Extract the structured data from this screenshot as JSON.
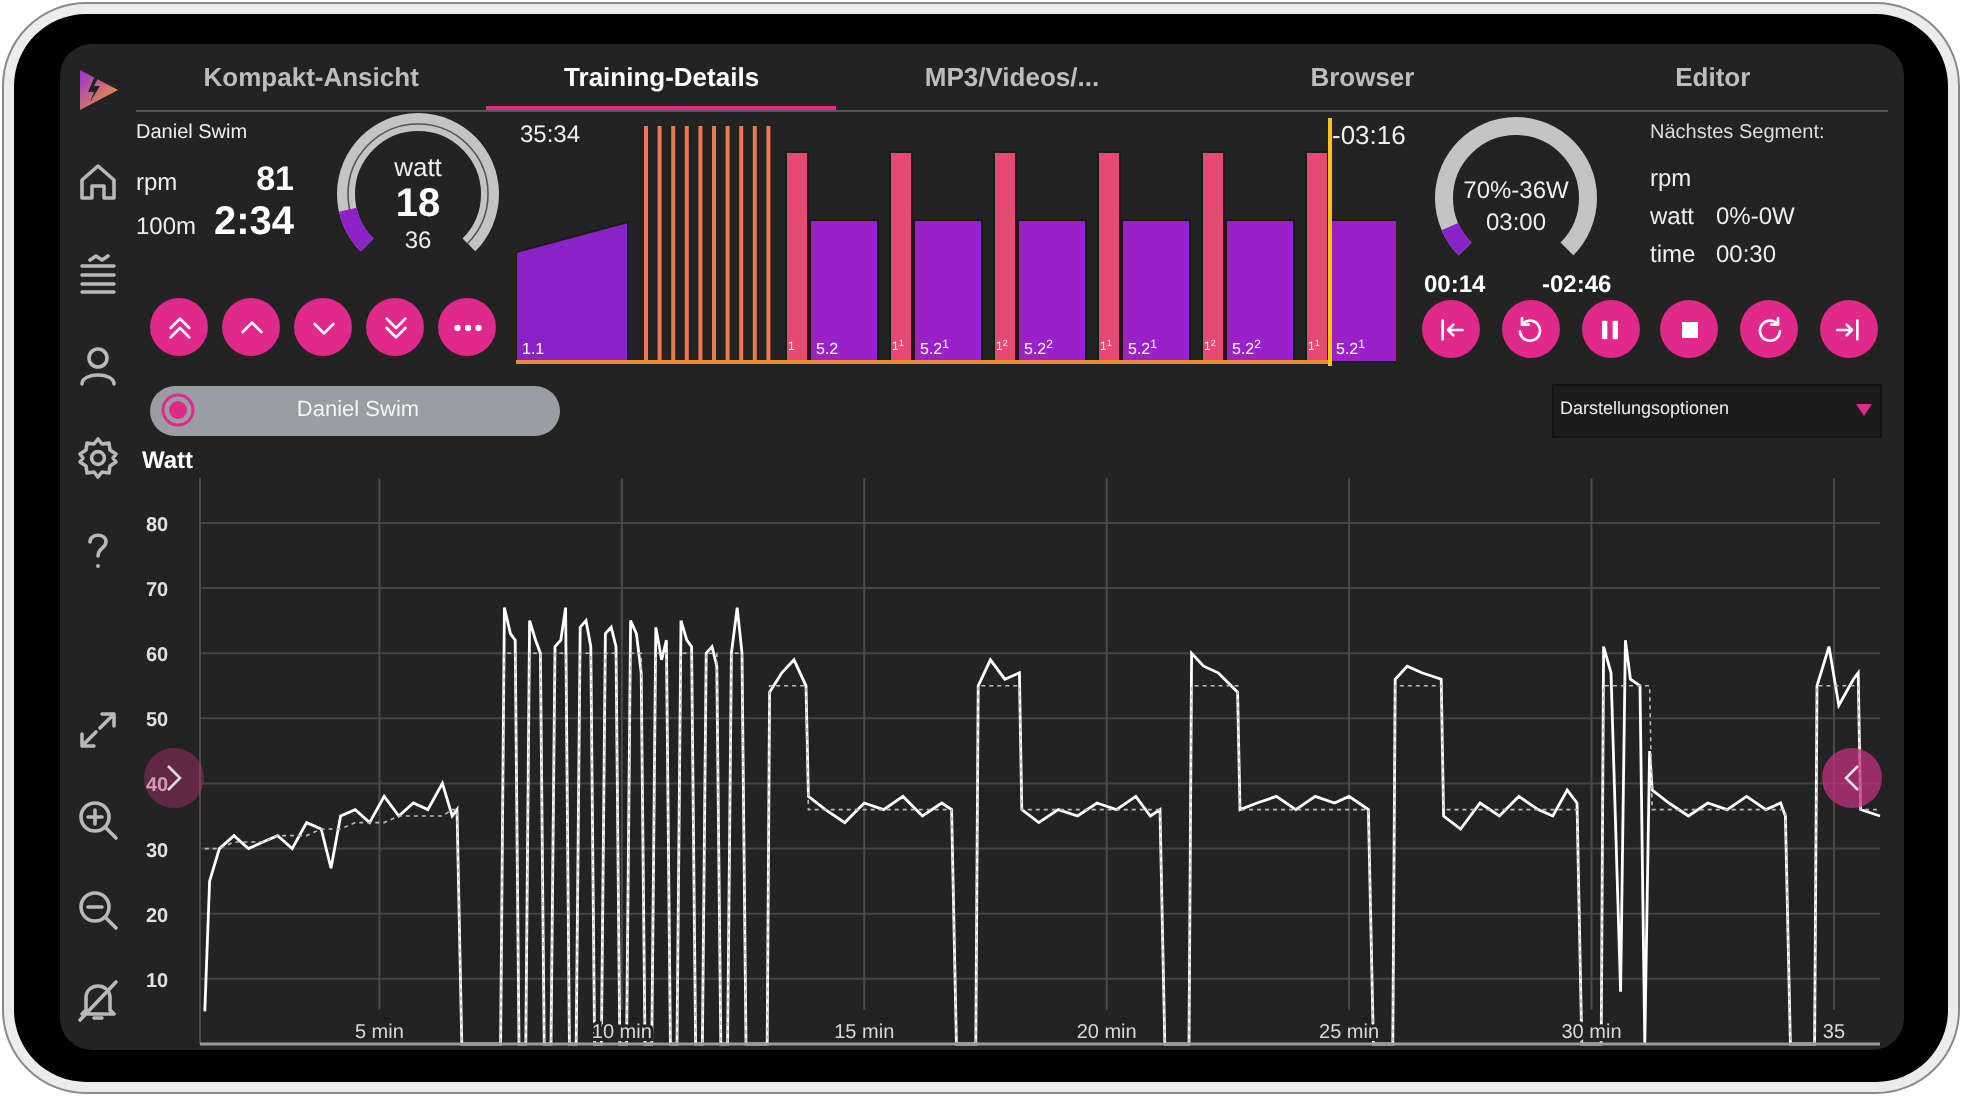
{
  "tabs": [
    {
      "label": "Kompakt-Ansicht",
      "selected": false
    },
    {
      "label": "Training-Details",
      "selected": true
    },
    {
      "label": "MP3/Videos/...",
      "selected": false
    },
    {
      "label": "Browser",
      "selected": false
    },
    {
      "label": "Editor",
      "selected": false
    }
  ],
  "rider": {
    "name": "Daniel Swim",
    "metrics": [
      {
        "label": "rpm",
        "value": "81"
      },
      {
        "label": "100m",
        "value": "2:34"
      }
    ]
  },
  "power_gauge": {
    "label": "watt",
    "value": "18",
    "target": "36",
    "level": 0.12
  },
  "workout_profile": {
    "elapsed": "35:34",
    "remaining": "-03:16",
    "level": 0.925,
    "segments": [
      {
        "kind": "ramp",
        "label": "1.1"
      },
      {
        "kind": "sprint"
      },
      {
        "kind": "sprint"
      },
      {
        "kind": "sprint"
      },
      {
        "kind": "sprint"
      },
      {
        "kind": "sprint"
      },
      {
        "kind": "sprint"
      },
      {
        "kind": "sprint"
      },
      {
        "kind": "sprint"
      },
      {
        "kind": "sprint"
      },
      {
        "kind": "sprint"
      },
      {
        "kind": "interval",
        "label": "1"
      },
      {
        "kind": "recovery",
        "label": "5.2"
      },
      {
        "kind": "interval",
        "label": "1$^{1}$"
      },
      {
        "kind": "recovery",
        "label": "5.2$^{1}$"
      },
      {
        "kind": "interval",
        "label": "1$^{2}$"
      },
      {
        "kind": "recovery",
        "label": "5.2$^{2}$"
      },
      {
        "kind": "interval",
        "label": "1$^{1}$"
      },
      {
        "kind": "recovery",
        "label": "5.2$^{1}$"
      },
      {
        "kind": "interval",
        "label": "1$^{2}$"
      },
      {
        "kind": "recovery",
        "label": "5.2$^{2}$"
      },
      {
        "kind": "interval",
        "label": "1$^{1}$"
      },
      {
        "kind": "recovery",
        "label": "5.2$^{1}$"
      }
    ]
  },
  "segment_gauge": {
    "target": "70%-36W",
    "duration": "03:00",
    "level": 0.08,
    "elapsed": "00:14",
    "remaining": "-02:46"
  },
  "next_segment": {
    "title": "Nächstes Segment:",
    "rows": [
      {
        "label": "rpm"
      },
      {
        "label": "watt",
        "value": "0%-0W"
      },
      {
        "label": "time",
        "value": "00:30"
      }
    ]
  },
  "user_chip": {
    "name": "Daniel Swim"
  },
  "display_options": {
    "label": "Darstellungsoptionen"
  },
  "power_chart": {
    "chart_data": {
      "type": "line",
      "ylabel": "Watt",
      "grid": true,
      "xlim": [
        1.3,
        35.95
      ],
      "ylim": [
        0,
        86.9
      ],
      "yticks": [
        10,
        20,
        30,
        40,
        50,
        60,
        70,
        80
      ],
      "xticks": [
        {
          "value": 5,
          "label": "5 min"
        },
        {
          "value": 10,
          "label": "10 min"
        },
        {
          "value": 15,
          "label": "15 min"
        },
        {
          "value": 20,
          "label": "20 min"
        },
        {
          "value": 25,
          "label": "25 min"
        },
        {
          "value": 30,
          "label": "30 min"
        },
        {
          "value": 35,
          "label": "35"
        }
      ],
      "x": [
        1.4,
        1.5,
        1.7,
        2.0,
        2.3,
        2.6,
        2.9,
        3.2,
        3.5,
        3.8,
        4.0,
        4.2,
        4.5,
        4.8,
        5.1,
        5.4,
        5.7,
        6.0,
        6.3,
        6.5,
        6.6,
        6.7,
        7.4,
        7.5,
        7.58,
        7.7,
        7.8,
        7.88,
        8.02,
        8.1,
        8.22,
        8.32,
        8.4,
        8.54,
        8.62,
        8.74,
        8.84,
        8.92,
        9.06,
        9.14,
        9.26,
        9.36,
        9.44,
        9.58,
        9.66,
        9.78,
        9.88,
        9.96,
        10.1,
        10.18,
        10.3,
        10.4,
        10.48,
        10.62,
        10.7,
        10.82,
        10.92,
        11.0,
        11.14,
        11.22,
        11.34,
        11.44,
        11.52,
        11.66,
        11.74,
        11.86,
        11.96,
        12.04,
        12.18,
        12.26,
        12.38,
        12.48,
        12.56,
        12.9,
        13.0,
        13.05,
        13.3,
        13.55,
        13.8,
        13.85,
        14.2,
        14.6,
        15.0,
        15.4,
        15.8,
        16.2,
        16.6,
        16.8,
        16.9,
        17.3,
        17.35,
        17.6,
        17.9,
        18.2,
        18.25,
        18.6,
        19.0,
        19.4,
        19.8,
        20.2,
        20.6,
        20.9,
        21.1,
        21.2,
        21.7,
        21.75,
        22.0,
        22.3,
        22.7,
        22.75,
        23.1,
        23.5,
        23.9,
        24.3,
        24.7,
        25.0,
        25.2,
        25.4,
        25.5,
        25.9,
        25.95,
        26.2,
        26.5,
        26.9,
        26.95,
        27.3,
        27.7,
        28.1,
        28.5,
        28.9,
        29.2,
        29.5,
        29.7,
        29.8,
        30.2,
        30.25,
        30.4,
        30.6,
        30.7,
        30.8,
        31.0,
        31.1,
        31.2,
        31.25,
        31.6,
        32.0,
        32.4,
        32.8,
        33.2,
        33.6,
        33.9,
        34.0,
        34.1,
        34.6,
        34.65,
        34.9,
        35.1,
        35.4,
        35.5,
        35.55,
        35.95
      ],
      "series": [
        {
          "color": "#ffffff",
          "line_style": "solid",
          "values": [
            5,
            25,
            30,
            32,
            30,
            31,
            32,
            30,
            34,
            33,
            27,
            35,
            36,
            34,
            38,
            35,
            37,
            36,
            40,
            35,
            36,
            0,
            0,
            0,
            67,
            63,
            62,
            0,
            0,
            65,
            62,
            60,
            0,
            0,
            61,
            62,
            67,
            0,
            0,
            64,
            65,
            61,
            0,
            0,
            63,
            64,
            61,
            0,
            0,
            65,
            63,
            57,
            0,
            0,
            64,
            59,
            62,
            0,
            0,
            65,
            62,
            61,
            0,
            0,
            60,
            61,
            58,
            0,
            0,
            60,
            67,
            60,
            0,
            0,
            0,
            54,
            57,
            59,
            55,
            38,
            36,
            34,
            37,
            36,
            38,
            35,
            37,
            36,
            0,
            0,
            55,
            59,
            56,
            57,
            36,
            34,
            36,
            35,
            37,
            36,
            38,
            35,
            36,
            0,
            0,
            60,
            58,
            57,
            54,
            36,
            37,
            38,
            36,
            38,
            37,
            38,
            37,
            36,
            0,
            0,
            56,
            58,
            57,
            56,
            35,
            33,
            37,
            35,
            38,
            36,
            35,
            39,
            37,
            0,
            0,
            61,
            57,
            8,
            62,
            56,
            55,
            0,
            45,
            39,
            37,
            35,
            37,
            36,
            38,
            36,
            37,
            35,
            0,
            0,
            55,
            61,
            52,
            56,
            57,
            36,
            35
          ]
        },
        {
          "color": "#bbbbbb",
          "line_style": "dashed",
          "values": [
            30,
            30,
            30,
            31,
            31,
            31,
            32,
            32,
            32,
            33,
            33,
            33,
            34,
            34,
            34,
            35,
            35,
            35,
            35,
            36,
            36,
            0,
            0,
            0,
            60,
            60,
            60,
            0,
            0,
            60,
            60,
            60,
            0,
            0,
            60,
            60,
            60,
            0,
            0,
            60,
            60,
            60,
            0,
            0,
            60,
            60,
            60,
            0,
            0,
            60,
            60,
            60,
            0,
            0,
            60,
            60,
            60,
            0,
            0,
            60,
            60,
            60,
            0,
            0,
            60,
            60,
            60,
            0,
            0,
            60,
            60,
            60,
            0,
            0,
            0,
            55,
            55,
            55,
            55,
            36,
            36,
            36,
            36,
            36,
            36,
            36,
            36,
            36,
            0,
            0,
            55,
            55,
            55,
            55,
            36,
            36,
            36,
            36,
            36,
            36,
            36,
            36,
            36,
            0,
            0,
            55,
            55,
            55,
            55,
            36,
            36,
            36,
            36,
            36,
            36,
            36,
            36,
            36,
            0,
            0,
            55,
            55,
            55,
            55,
            36,
            36,
            36,
            36,
            36,
            36,
            36,
            36,
            36,
            0,
            0,
            55,
            55,
            55,
            55,
            55,
            55,
            55,
            55,
            36,
            36,
            36,
            36,
            36,
            36,
            36,
            36,
            36,
            0,
            0,
            55,
            55,
            55,
            55,
            55,
            36,
            36
          ]
        }
      ]
    }
  }
}
